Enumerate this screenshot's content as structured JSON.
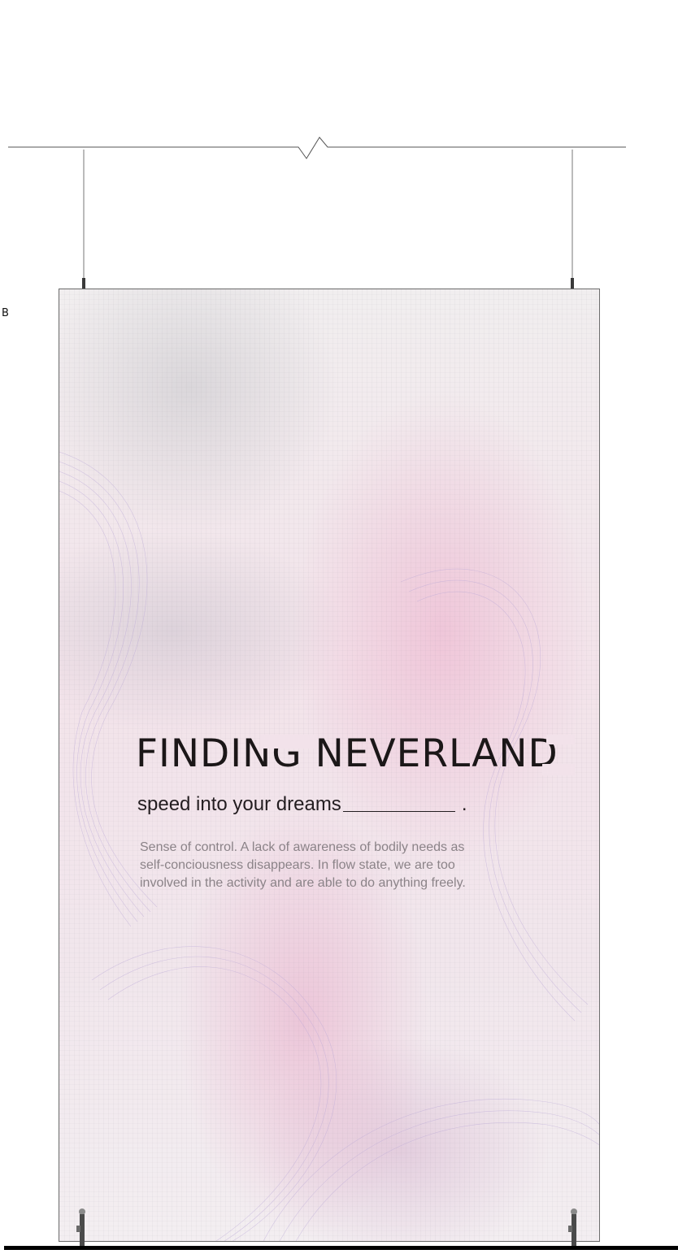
{
  "page": {
    "marker_label": "B"
  },
  "poster": {
    "title": "FINDING NEVERLAND",
    "tagline": "speed into your dreams",
    "tagline_suffix": ".",
    "body": "Sense of control. A lack of awareness of bodily needs as self-conciousness disappears. In flow state, we are too involved in the activity and are able to do anything freely."
  },
  "colors": {
    "panel_tint": "#f2e2ea",
    "title_text": "#1b1718",
    "body_text": "#8b8388",
    "contour_lines": "#b9a7d6"
  }
}
